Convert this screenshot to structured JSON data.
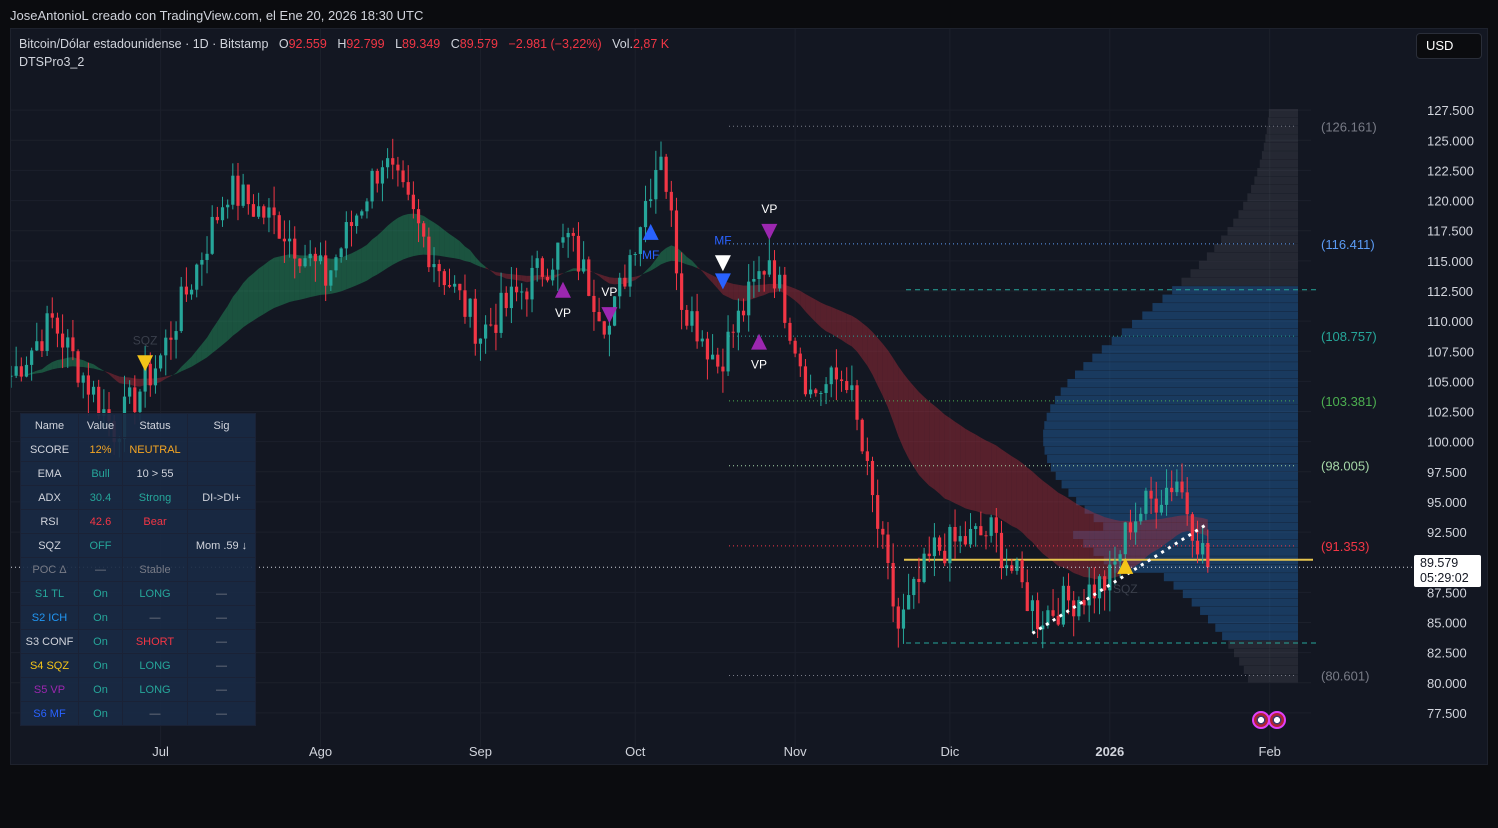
{
  "attribution": "JoseAntonioL creado con TradingView.com, el Ene 20, 2026 18:30 UTC",
  "legend": {
    "symbol": "Bitcoin/Dólar estadounidense · 1D · Bitstamp",
    "open_label": "O",
    "open": "92.559",
    "high_label": "H",
    "high": "92.799",
    "low_label": "L",
    "low": "89.349",
    "close_label": "C",
    "close": "89.579",
    "change": "−2.981 (−3,22%)",
    "vol_label": "Vol.",
    "vol": "2,87 K"
  },
  "indicator_name": "DTSPro3_2",
  "currency": "USD",
  "last_price": {
    "price": "89.579",
    "countdown": "05:29:02"
  },
  "dashboard": {
    "headers": [
      "Name",
      "Value",
      "Status",
      "Sig"
    ],
    "rows": [
      {
        "name": "SCORE",
        "value": "12%",
        "status": "NEUTRAL",
        "sig": "",
        "name_color": "#d1d4dc",
        "value_color": "#f5a623",
        "status_color": "#f5a623"
      },
      {
        "name": "EMA",
        "value": "Bull",
        "status": "10 > 55",
        "sig": "",
        "name_color": "#d1d4dc",
        "value_color": "#26a69a",
        "status_color": "#d1d4dc"
      },
      {
        "name": "ADX",
        "value": "30.4",
        "status": "Strong",
        "sig": "DI->DI+",
        "name_color": "#d1d4dc",
        "value_color": "#26a69a",
        "status_color": "#26a69a"
      },
      {
        "name": "RSI",
        "value": "42.6",
        "status": "Bear",
        "sig": "",
        "name_color": "#d1d4dc",
        "value_color": "#f23645",
        "status_color": "#f23645"
      },
      {
        "name": "SQZ",
        "value": "OFF",
        "status": "",
        "sig": "Mom .59 ↓",
        "name_color": "#d1d4dc",
        "value_color": "#26a69a",
        "status_color": "#d1d4dc"
      },
      {
        "name": "POC Δ",
        "value": "—",
        "status": "Stable",
        "sig": "",
        "name_color": "#787b86",
        "value_color": "#787b86",
        "status_color": "#787b86"
      },
      {
        "name": "S1 TL",
        "value": "On",
        "status": "LONG",
        "sig": "—",
        "name_color": "#26a69a",
        "value_color": "#26a69a",
        "status_color": "#26a69a"
      },
      {
        "name": "S2 ICH",
        "value": "On",
        "status": "—",
        "sig": "—",
        "name_color": "#2196f3",
        "value_color": "#26a69a",
        "status_color": "#787b86"
      },
      {
        "name": "S3 CONF",
        "value": "On",
        "status": "SHORT",
        "sig": "—",
        "name_color": "#d1d4dc",
        "value_color": "#26a69a",
        "status_color": "#f23645"
      },
      {
        "name": "S4 SQZ",
        "value": "On",
        "status": "LONG",
        "sig": "—",
        "name_color": "#f5c518",
        "value_color": "#26a69a",
        "status_color": "#26a69a"
      },
      {
        "name": "S5 VP",
        "value": "On",
        "status": "LONG",
        "sig": "—",
        "name_color": "#9c27b0",
        "value_color": "#26a69a",
        "status_color": "#26a69a"
      },
      {
        "name": "S6 MF",
        "value": "On",
        "status": "—",
        "sig": "—",
        "name_color": "#2962ff",
        "value_color": "#26a69a",
        "status_color": "#787b86"
      }
    ]
  },
  "chart_data": {
    "type": "candlestick",
    "price_axis_labels": [
      "127.500",
      "125.000",
      "122.500",
      "120.000",
      "117.500",
      "115.000",
      "112.500",
      "110.000",
      "107.500",
      "105.000",
      "102.500",
      "100.000",
      "97.500",
      "95.000",
      "92.500",
      "87.500",
      "85.000",
      "82.500",
      "80.000",
      "77.500"
    ],
    "price_axis_values": [
      127500,
      125000,
      122500,
      120000,
      117500,
      115000,
      112500,
      110000,
      107500,
      105000,
      102500,
      100000,
      97500,
      95000,
      92500,
      87500,
      85000,
      82500,
      80000,
      77500
    ],
    "ylim": [
      75500,
      130500
    ],
    "time_axis": [
      {
        "label": "Jul",
        "date": "2025-07-01"
      },
      {
        "label": "Ago",
        "date": "2025-08-01"
      },
      {
        "label": "Sep",
        "date": "2025-09-01"
      },
      {
        "label": "Oct",
        "date": "2025-10-01"
      },
      {
        "label": "Nov",
        "date": "2025-11-01"
      },
      {
        "label": "Dic",
        "date": "2025-12-01"
      },
      {
        "label": "2026",
        "date": "2026-01-01",
        "bold": true
      },
      {
        "label": "Feb",
        "date": "2026-02-01"
      }
    ],
    "xlim": [
      "2025-06-02",
      "2026-02-09"
    ],
    "level_lines": [
      {
        "label": "(126.161)",
        "value": 126161,
        "color": "#787b86",
        "style": "dotted"
      },
      {
        "label": "(116.411)",
        "value": 116411,
        "color": "#5b9cf6",
        "style": "dotted"
      },
      {
        "label": "(108.757)",
        "value": 108757,
        "color": "#26a69a",
        "style": "dotted"
      },
      {
        "label": "(103.381)",
        "value": 103381,
        "color": "#4caf50",
        "style": "dotted"
      },
      {
        "label": "(98.005)",
        "value": 98005,
        "color": "#a5d6a7",
        "style": "dotted"
      },
      {
        "label": "(91.353)",
        "value": 91353,
        "color": "#f23645",
        "style": "dotted"
      },
      {
        "label": "(80.601)",
        "value": 80601,
        "color": "#787b86",
        "style": "dotted"
      }
    ],
    "poc_value": 90200,
    "value_area": [
      83300,
      112600
    ],
    "last_close": 89579,
    "trendline": {
      "from": {
        "date": "2025-12-17",
        "value": 84100
      },
      "to": {
        "date": "2026-01-20",
        "value": 93200
      }
    },
    "closes_keypoints": [
      {
        "date": "2025-06-02",
        "value": 105500
      },
      {
        "date": "2025-06-10",
        "value": 110000
      },
      {
        "date": "2025-06-22",
        "value": 101000
      },
      {
        "date": "2025-07-01",
        "value": 107000
      },
      {
        "date": "2025-07-14",
        "value": 121000
      },
      {
        "date": "2025-07-24",
        "value": 118000
      },
      {
        "date": "2025-08-02",
        "value": 113500
      },
      {
        "date": "2025-08-13",
        "value": 123500
      },
      {
        "date": "2025-08-22",
        "value": 116000
      },
      {
        "date": "2025-09-01",
        "value": 109000
      },
      {
        "date": "2025-09-10",
        "value": 113000
      },
      {
        "date": "2025-09-18",
        "value": 116800
      },
      {
        "date": "2025-09-26",
        "value": 109500
      },
      {
        "date": "2025-10-06",
        "value": 124500
      },
      {
        "date": "2025-10-10",
        "value": 112000
      },
      {
        "date": "2025-10-17",
        "value": 106500
      },
      {
        "date": "2025-10-27",
        "value": 115500
      },
      {
        "date": "2025-11-04",
        "value": 104000
      },
      {
        "date": "2025-11-11",
        "value": 105500
      },
      {
        "date": "2025-11-21",
        "value": 84500
      },
      {
        "date": "2025-11-28",
        "value": 91000
      },
      {
        "date": "2025-12-09",
        "value": 92500
      },
      {
        "date": "2025-12-18",
        "value": 85500
      },
      {
        "date": "2026-01-01",
        "value": 88500
      },
      {
        "date": "2026-01-05",
        "value": 93500
      },
      {
        "date": "2026-01-14",
        "value": 97000
      },
      {
        "date": "2026-01-20",
        "value": 89579
      }
    ],
    "markers": [
      {
        "date": "2025-06-28",
        "value": 106500,
        "shape": "tri-down",
        "color": "#f5c518",
        "label": "SQZ",
        "label_color": "#3a3f4b"
      },
      {
        "date": "2025-09-17",
        "value": 112600,
        "shape": "tri-up",
        "color": "#9c27b0",
        "label": "VP",
        "label_color": "#ffffff"
      },
      {
        "date": "2025-09-26",
        "value": 110500,
        "shape": "tri-down",
        "color": "#9c27b0",
        "label": "VP",
        "label_color": "#ffffff"
      },
      {
        "date": "2025-10-04",
        "value": 117400,
        "shape": "tri-up",
        "color": "#2962ff",
        "label": "MF",
        "label_color": "#2962ff"
      },
      {
        "date": "2025-10-18",
        "value": 114800,
        "shape": "tri-down",
        "color": "#ffffff",
        "label": "MF",
        "label_color": "#2962ff"
      },
      {
        "date": "2025-10-18",
        "value": 113300,
        "shape": "tri-down",
        "color": "#2962ff",
        "label": "",
        "label_color": "#ffffff"
      },
      {
        "date": "2025-10-25",
        "value": 108300,
        "shape": "tri-up",
        "color": "#9c27b0",
        "label": "VP",
        "label_color": "#ffffff"
      },
      {
        "date": "2025-10-27",
        "value": 117400,
        "shape": "tri-down",
        "color": "#9c27b0",
        "label": "VP",
        "label_color": "#ffffff"
      },
      {
        "date": "2026-01-04",
        "value": 89700,
        "shape": "tri-up",
        "color": "#f5c518",
        "label": "SQZ",
        "label_color": "#3a3f4b"
      }
    ]
  }
}
